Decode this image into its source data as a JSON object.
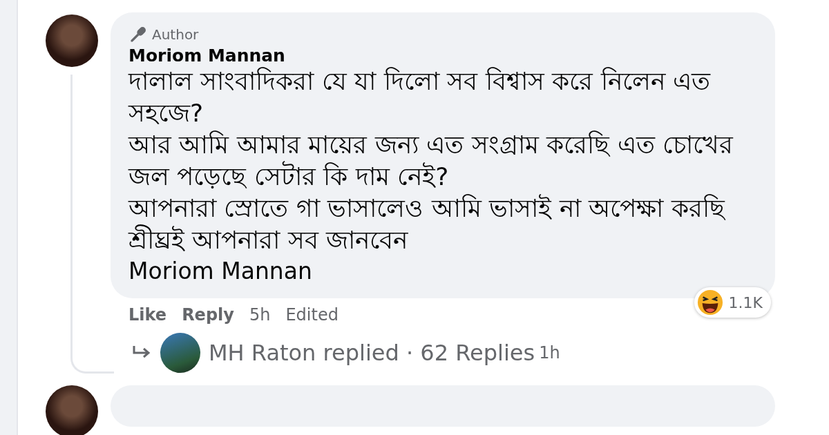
{
  "comment": {
    "badge": "Author",
    "author": "Moriom Mannan",
    "body": [
      "দালাল সাংবাদিকরা যে যা দিলো সব বিশ্বাস করে নিলেন এত সহজে?",
      "আর আমি আমার মায়ের জন্য এত সংগ্রাম করেছি এত চোখের জল পড়েছে সেটার কি দাম নেই?",
      "আপনারা স্রোতে গা ভাসালেও আমি ভাসাই না অপেক্ষা করছি শ্রীঘ্রই আপনারা সব জানবেন"
    ],
    "signature": "Moriom Mannan",
    "reaction_count": "1.1K",
    "actions": [
      {
        "kind": "link",
        "label": "Like"
      },
      {
        "kind": "link",
        "label": "Reply"
      },
      {
        "kind": "meta",
        "label": "5h"
      },
      {
        "kind": "meta",
        "label": "Edited"
      }
    ],
    "replies": {
      "text": "MH Raton replied · 62 Replies",
      "time": "1h"
    }
  }
}
